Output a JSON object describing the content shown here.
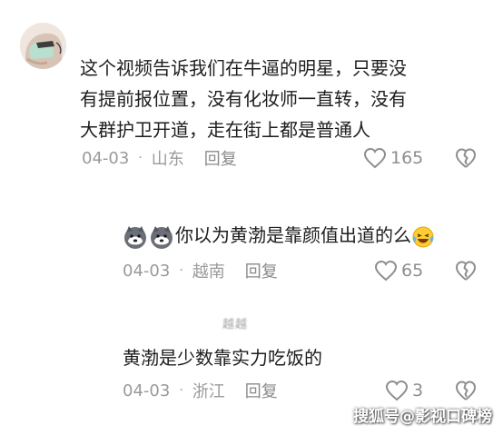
{
  "comments": [
    {
      "username": "",
      "lines": [
        "这个视频告诉我们在牛逼的明星，只要没",
        "有提前报位置，没有化妆师一直转，没有",
        "大群护卫开道，走在街上都是普通人"
      ],
      "date": "04-03",
      "location": "山东",
      "reply_label": "回复",
      "likes": "165"
    },
    {
      "username": "",
      "text": "你以为黄渤是靠颜值出道的么",
      "date": "04-03",
      "location": "越南",
      "reply_label": "回复",
      "likes": "65"
    },
    {
      "username": "越越",
      "text": "黄渤是少数靠实力吃饭的",
      "date": "04-03",
      "location": "浙江",
      "reply_label": "回复",
      "likes": "3"
    }
  ],
  "meta_separator": "·",
  "watermark": "搜狐号@影视口碑榜",
  "colors": {
    "meta_text": "#9a9a9a",
    "comment_text": "#1d1d1d",
    "icon_stroke": "#8e8e8e"
  },
  "icons": [
    "heart-outline-icon",
    "broken-heart-icon",
    "husky-dog-emoji",
    "laughing-tears-emoji"
  ]
}
